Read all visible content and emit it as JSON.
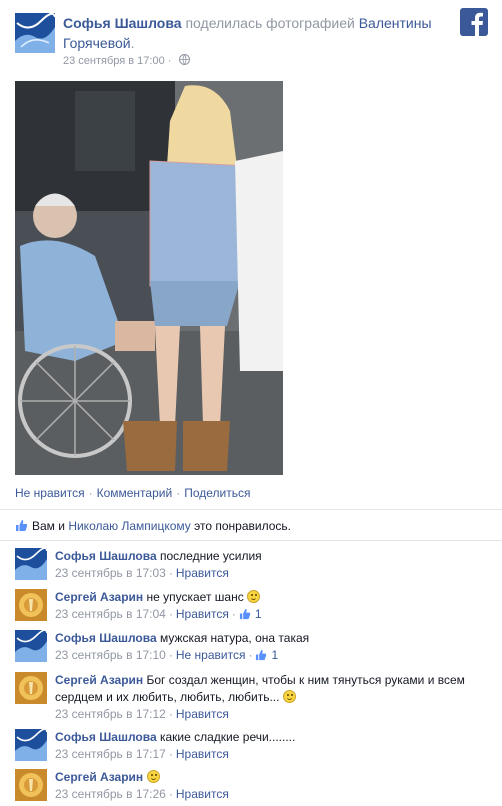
{
  "post": {
    "author": "Софья Шашлова",
    "shared_text": " поделилась фотографией ",
    "photo_owner": "Валентины Горячевой",
    "period": ".",
    "time": "23 сентября в 17:00",
    "globe_sep": " · "
  },
  "actions": {
    "unlike": "Не нравится",
    "comment": "Комментарий",
    "share": "Поделиться",
    "sep": "·"
  },
  "likes": {
    "prefix": "Вам и ",
    "person": "Николаю Лампицкому",
    "suffix": " это понравилось."
  },
  "comments": [
    {
      "name": "Софья Шашлова",
      "text": "последние усилия",
      "time": "23 сентябрь в 17:03",
      "like": "Нравится",
      "count": "",
      "avatar": "sofia",
      "emoji": false
    },
    {
      "name": "Сергей Азарин",
      "text": "не упускает шанс",
      "time": "23 сентябрь в 17:04",
      "like": "Нравится",
      "count": "1",
      "avatar": "sergey",
      "emoji": true
    },
    {
      "name": "Софья Шашлова",
      "text": "мужская натура, она такая",
      "time": "23 сентябрь в 17:10",
      "like": "Не нравится",
      "count": "1",
      "avatar": "sofia",
      "emoji": false
    },
    {
      "name": "Сергей Азарин",
      "text": "Бог создал женщин, чтобы к ним тянуться руками и всем сердцем и их любить, любить, любить...",
      "time": "23 сентябрь в 17:12",
      "like": "Нравится",
      "count": "",
      "avatar": "sergey",
      "emoji": true
    },
    {
      "name": "Софья Шашлова",
      "text": "какие сладкие речи........",
      "time": "23 сентябрь в 17:17",
      "like": "Нравится",
      "count": "",
      "avatar": "sofia",
      "emoji": false
    },
    {
      "name": "Сергей Азарин",
      "text": "",
      "time": "23 сентябрь в 17:26",
      "like": "Нравится",
      "count": "",
      "avatar": "sergey",
      "emoji": true
    }
  ],
  "meta_sep": "·",
  "colors": {
    "link": "#3b5998",
    "muted": "#9197a3",
    "brand": "#3b5998"
  },
  "icons": {
    "logo": "facebook-logo-icon",
    "globe": "globe-icon",
    "thumb": "thumbs-up-icon",
    "emoji": "smiley-icon"
  }
}
